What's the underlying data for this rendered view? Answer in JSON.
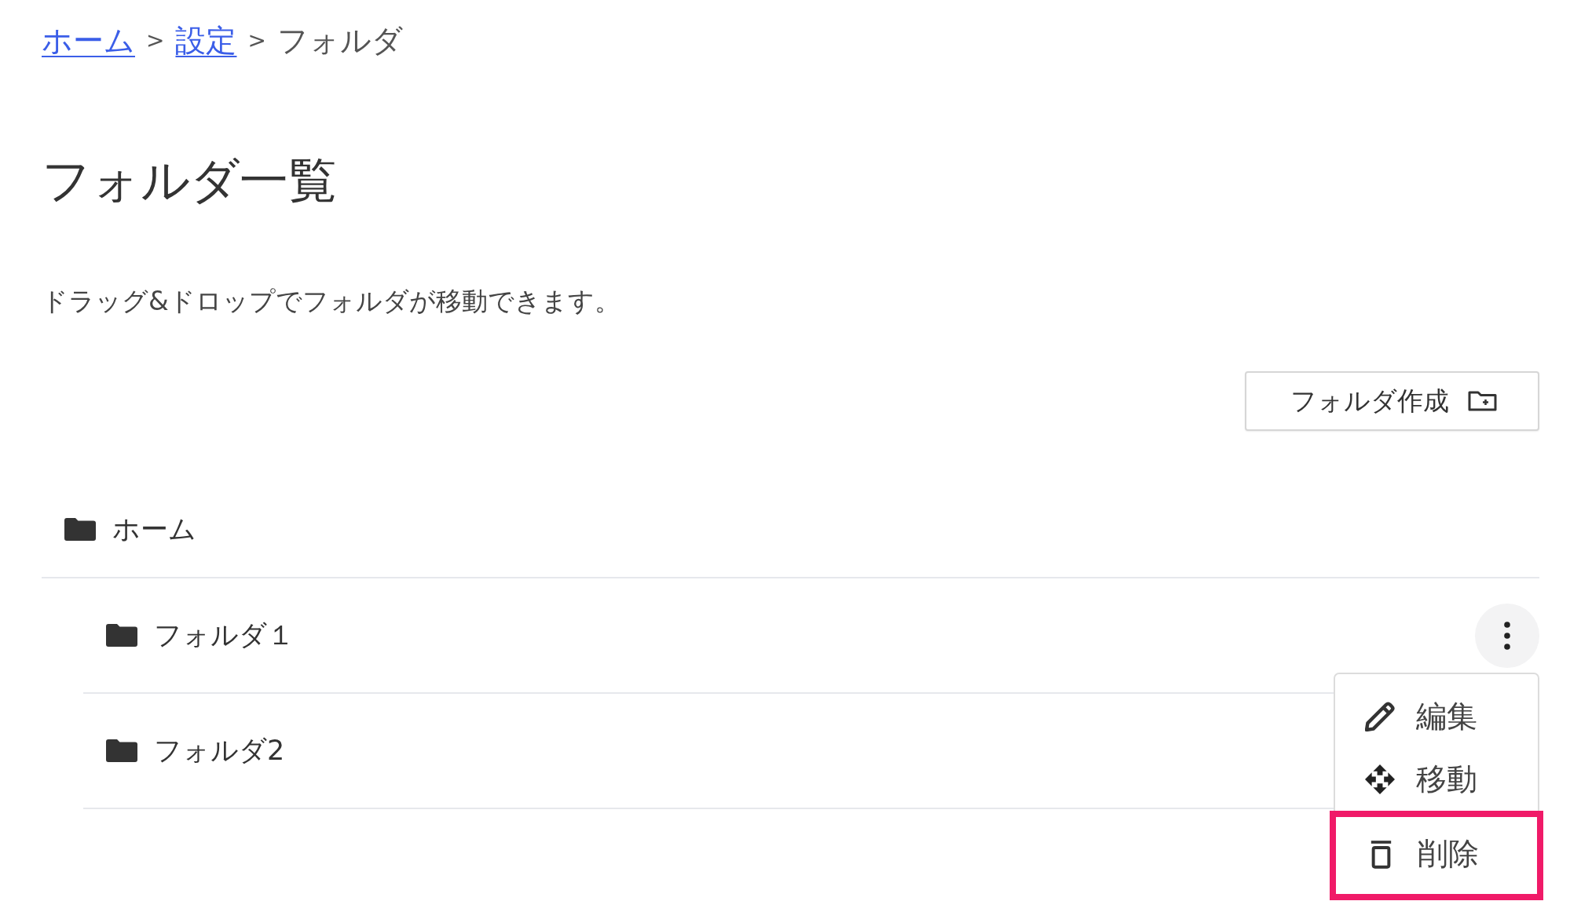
{
  "breadcrumb": [
    {
      "label": "ホーム",
      "link": true
    },
    {
      "separator": ">",
      "label": "設定",
      "link": true
    },
    {
      "separator": ">",
      "label": "フォルダ",
      "link": false
    }
  ],
  "title": "フォルダ一覧",
  "description": "ドラッグ&ドロップでフォルダが移動できます。",
  "create_button": {
    "label": "フォルダ作成"
  },
  "tree": [
    {
      "label": "ホーム",
      "children": [
        {
          "label": "フォルダ１",
          "menu_open": true,
          "menu": [
            {
              "kind": "edit",
              "label": "編集",
              "highlighted": false
            },
            {
              "kind": "move",
              "label": "移動",
              "highlighted": false
            },
            {
              "kind": "delete",
              "label": "削除",
              "highlighted": true
            }
          ]
        },
        {
          "label": "フォルダ2",
          "menu_open": false
        }
      ]
    }
  ]
}
